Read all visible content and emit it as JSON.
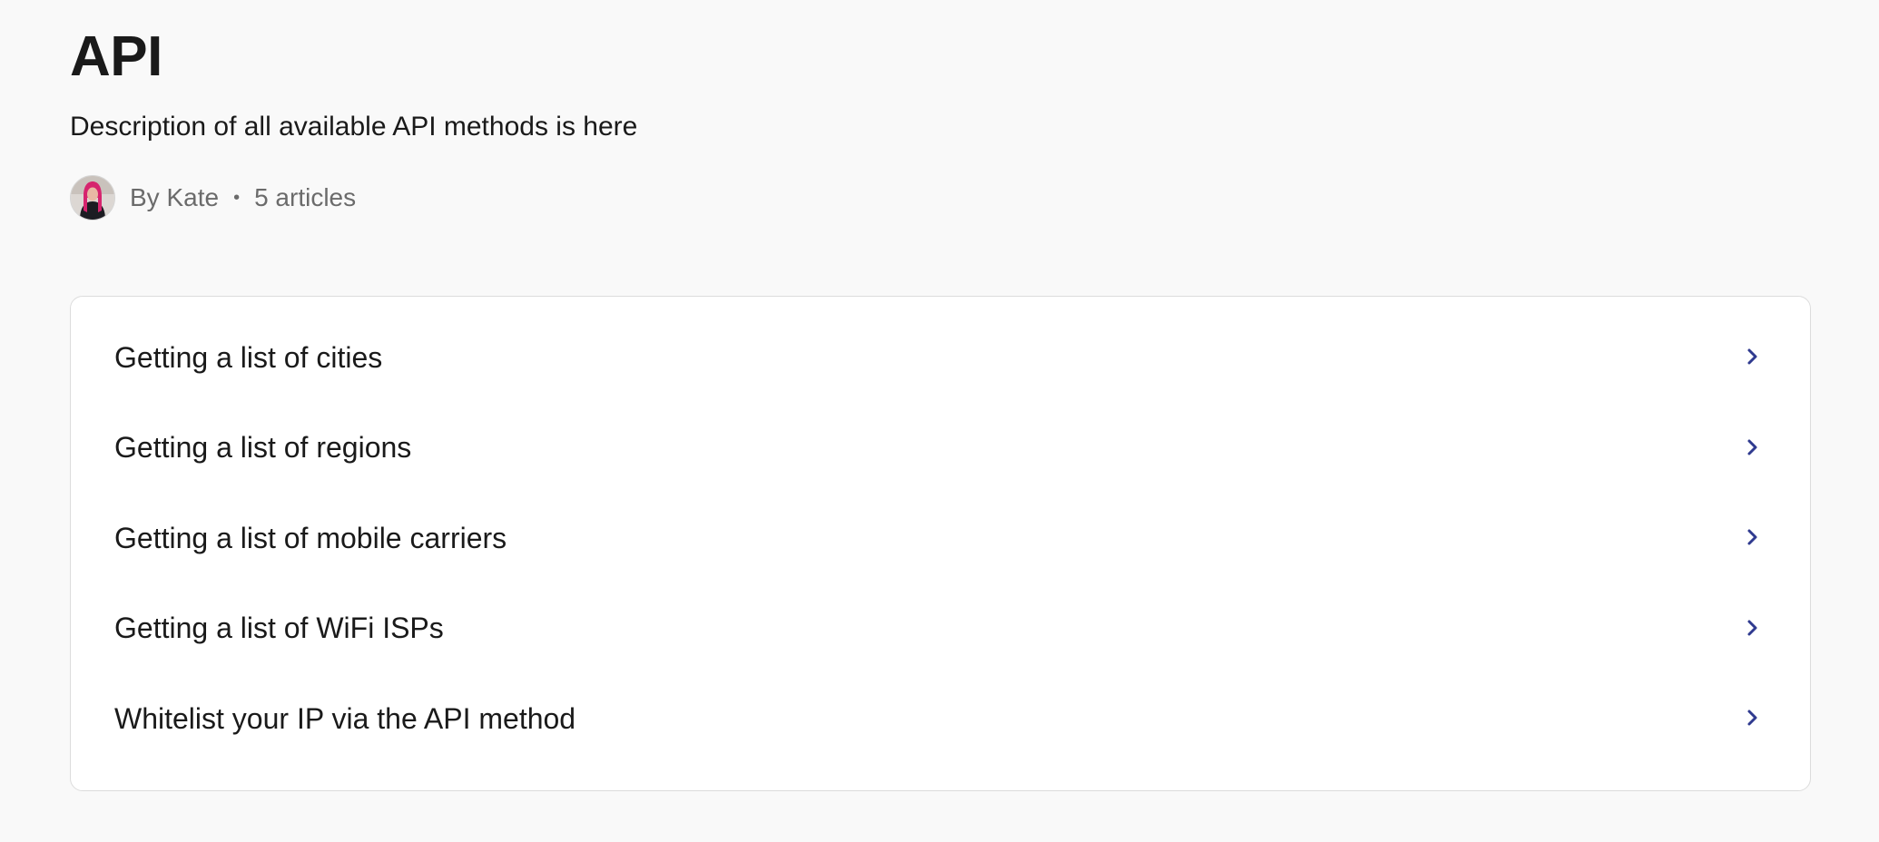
{
  "collection": {
    "title": "API",
    "description": "Description of all available API methods is here",
    "author_text": "By Kate",
    "separator": "•",
    "article_count_text": "5 articles"
  },
  "articles": [
    {
      "title": "Getting a list of cities",
      "icon": "chevron-right-icon"
    },
    {
      "title": "Getting a list of regions",
      "icon": "chevron-right-icon"
    },
    {
      "title": "Getting a list of mobile carriers",
      "icon": "chevron-right-icon"
    },
    {
      "title": "Getting a list of WiFi ISPs",
      "icon": "chevron-right-icon"
    },
    {
      "title": "Whitelist your IP via the API method",
      "icon": "chevron-right-icon"
    }
  ],
  "colors": {
    "background": "#f9f9f9",
    "card_background": "#ffffff",
    "card_border": "#dcdcdc",
    "text_primary": "#1a1a1a",
    "text_muted": "#6b6b6b",
    "chevron": "#2f3a8f"
  }
}
